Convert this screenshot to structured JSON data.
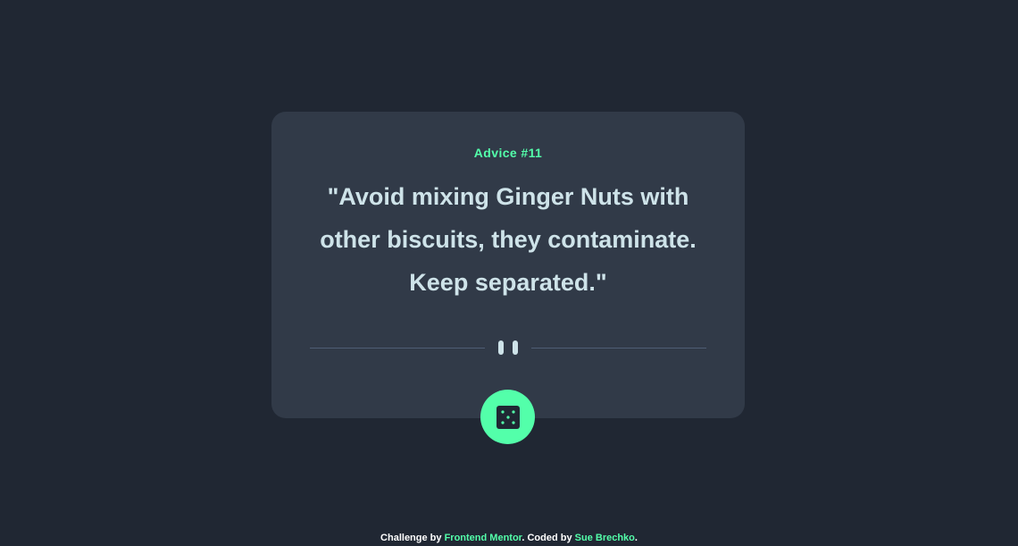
{
  "advice": {
    "id_label": "Advice #11",
    "text": "\"Avoid mixing Ginger Nuts with other biscuits, they contaminate. Keep separated.\""
  },
  "icons": {
    "divider": "pause-icon",
    "dice": "dice-icon"
  },
  "footer": {
    "prefix": "Challenge by ",
    "link1_label": "Frontend Mentor",
    "middle": ". Coded by ",
    "link2_label": "Sue Brechko",
    "suffix": "."
  },
  "colors": {
    "background": "#202733",
    "card": "#313a48",
    "accent": "#53ffaa",
    "text": "#cee3e9",
    "divider": "#4f5d74"
  }
}
